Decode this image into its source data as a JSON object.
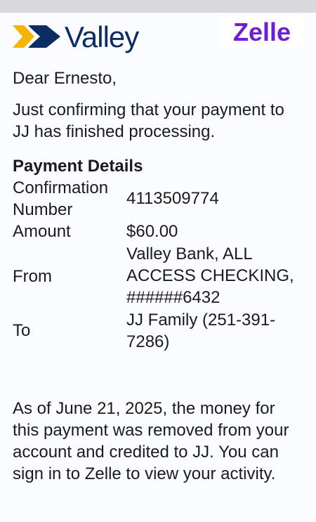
{
  "header": {
    "bank_logo_text": "Valley",
    "service_logo_text": "Zelle",
    "service_logo_mark": "®"
  },
  "message": {
    "greeting": "Dear Ernesto,",
    "intro": "Just confirming that your payment to JJ has finished processing.",
    "details_title": "Payment Details",
    "details": [
      {
        "label": "Confirmation Number",
        "value": "4113509774"
      },
      {
        "label": "Amount",
        "value": "$60.00"
      },
      {
        "label": "From",
        "value": "Valley Bank, ALL ACCESS CHECKING, ######6432"
      },
      {
        "label": "To",
        "value": "JJ Family (251-391-7286)"
      }
    ],
    "footer": "As of June 21, 2025, the money for this payment was removed from your account and credited to JJ. You can sign in to Zelle to view your activity."
  },
  "colors": {
    "valley_blue": "#0b2d64",
    "valley_gold": "#f4b400",
    "zelle_purple": "#6d1ed4"
  },
  "icons": {
    "valley_mark": "valley-chevron-logo-icon"
  }
}
